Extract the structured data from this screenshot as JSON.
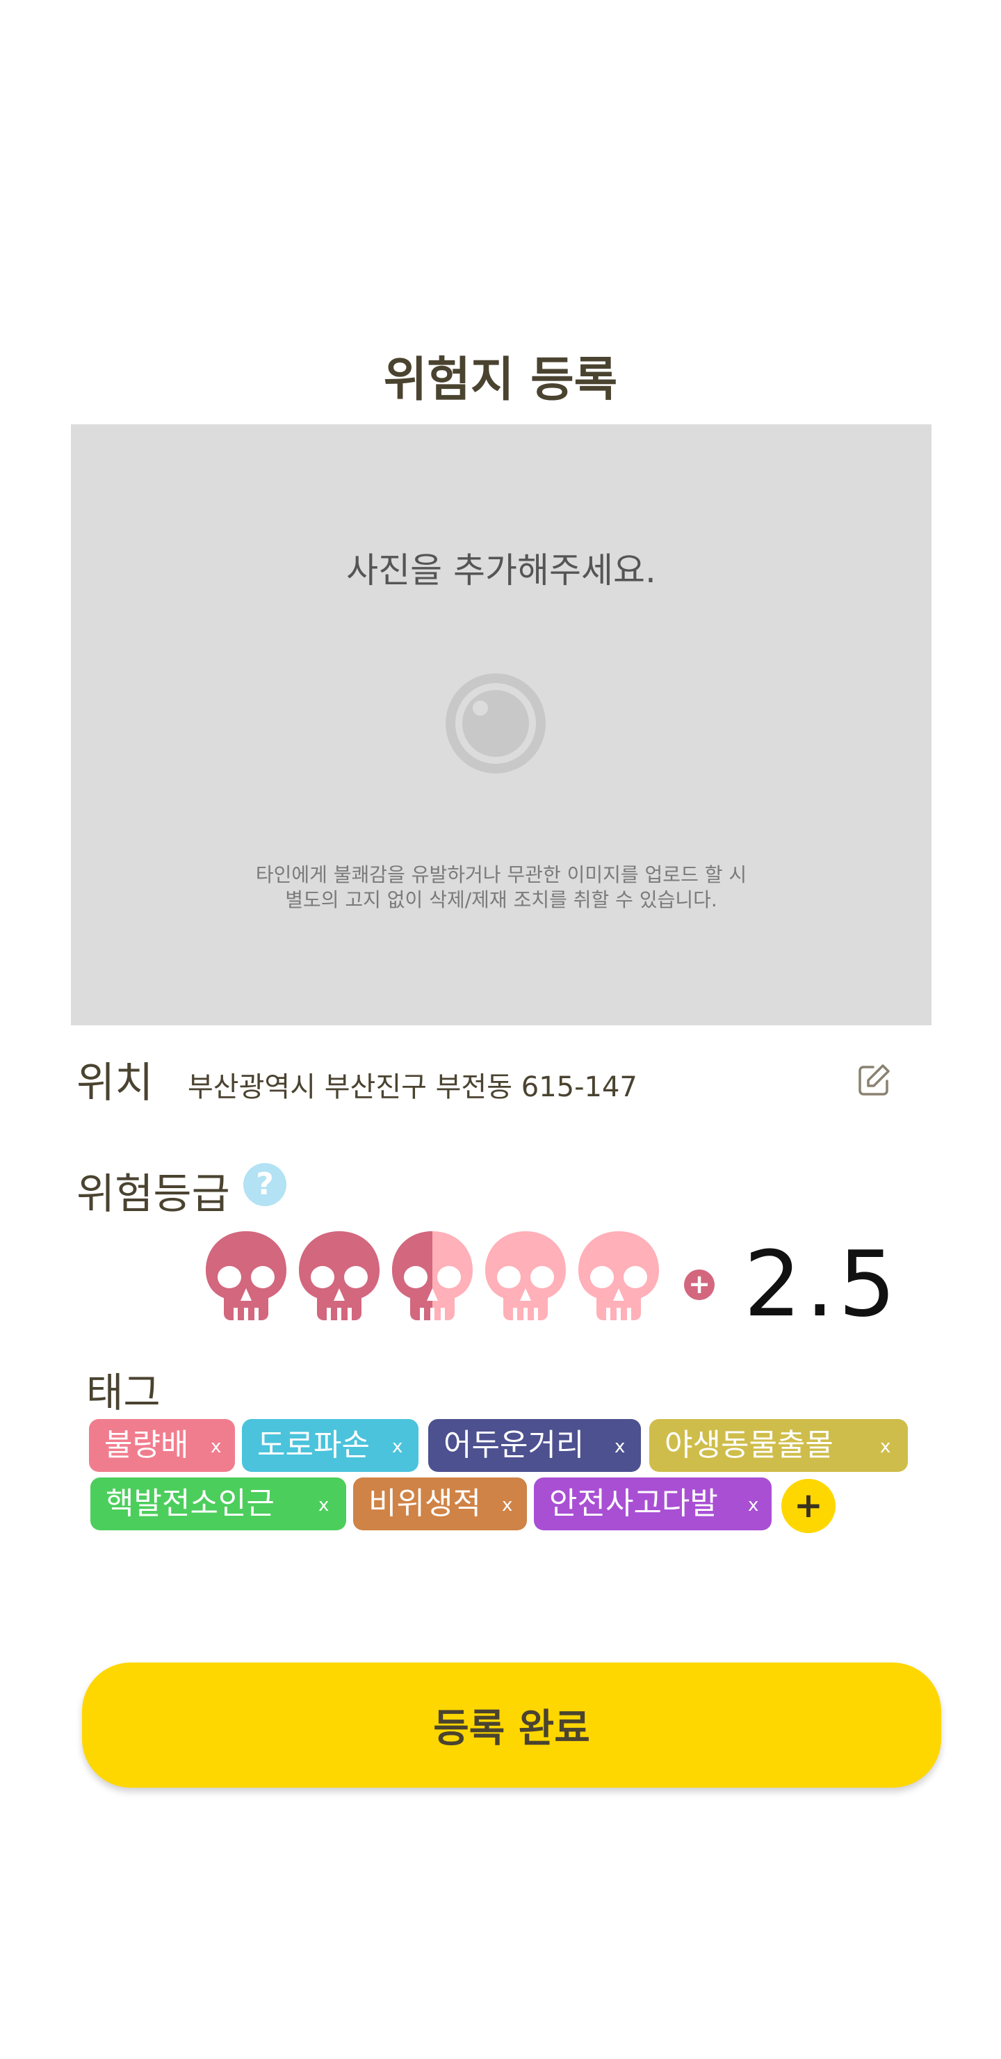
{
  "header": {
    "title": "위험지 등록"
  },
  "photo": {
    "prompt": "사진을 추가해주세요.",
    "notice_line1": "타인에게 불쾌감을 유발하거나 무관한 이미지를 업로드 할 시",
    "notice_line2": "별도의 고지 없이 삭제/제재 조치를 취할 수 있습니다.",
    "icon": "camera-icon"
  },
  "location": {
    "label": "위치",
    "address": "부산광역시 부산진구 부전동 615-147",
    "edit_icon": "edit-icon"
  },
  "risk": {
    "label": "위험등급",
    "help_symbol": "?",
    "rating": 2.5,
    "rating_text": "2.5",
    "max": 5,
    "add_symbol": "+",
    "filled_color": "#d2677e",
    "empty_color": "#ffb0b8"
  },
  "tags": {
    "label": "태그",
    "remove_symbol": "x",
    "add_symbol": "+",
    "items": [
      {
        "label": "불량배",
        "color": "#f07d8e"
      },
      {
        "label": "도로파손",
        "color": "#4bc3dc"
      },
      {
        "label": "어두운거리",
        "color": "#4d518f"
      },
      {
        "label": "야생동물출몰",
        "color": "#cfbd4b"
      },
      {
        "label": "핵발전소인근",
        "color": "#4cce5c"
      },
      {
        "label": "비위생적",
        "color": "#cf8346"
      },
      {
        "label": "안전사고다발",
        "color": "#a94fd4"
      }
    ]
  },
  "submit": {
    "label": "등록 완료",
    "color": "#ffd700"
  }
}
